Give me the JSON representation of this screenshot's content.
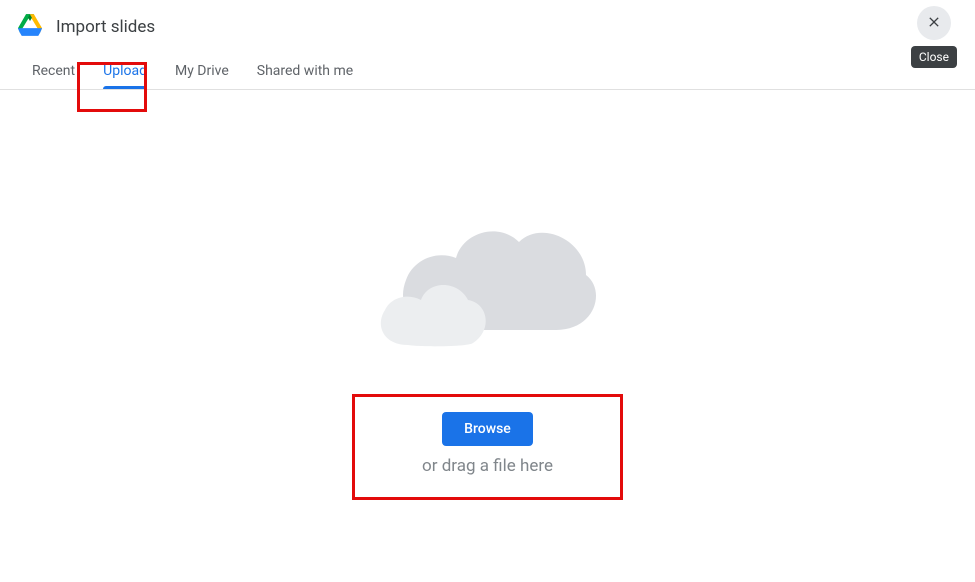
{
  "header": {
    "title": "Import slides",
    "close_tooltip": "Close"
  },
  "tabs": [
    {
      "label": "Recent",
      "active": false
    },
    {
      "label": "Upload",
      "active": true
    },
    {
      "label": "My Drive",
      "active": false
    },
    {
      "label": "Shared with me",
      "active": false
    }
  ],
  "upload": {
    "browse_label": "Browse",
    "drag_text": "or drag a file here"
  },
  "colors": {
    "accent": "#1a73e8",
    "highlight": "#e30b0b"
  }
}
